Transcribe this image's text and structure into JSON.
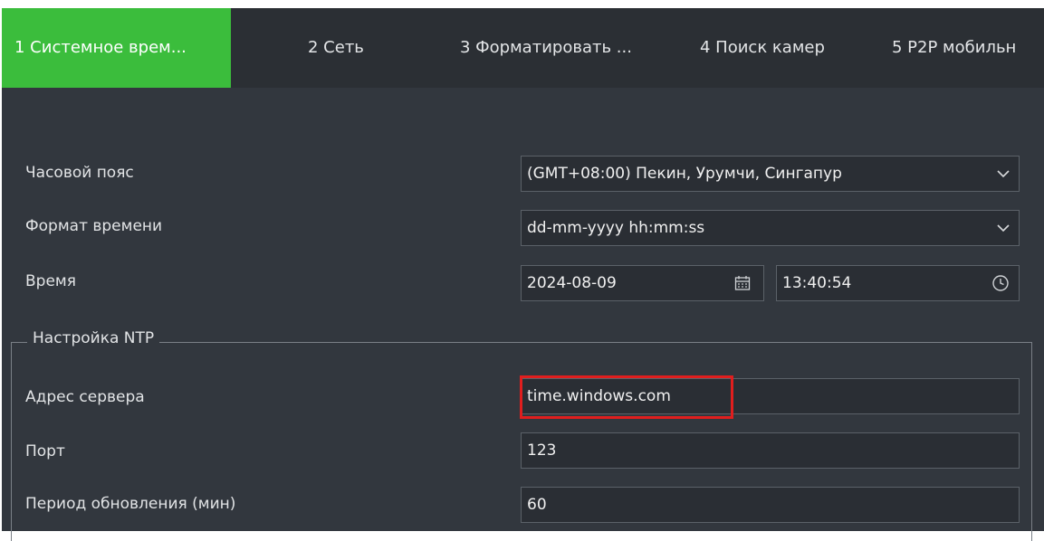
{
  "tabs": [
    {
      "label": "1 Системное врем...",
      "active": true
    },
    {
      "label": "2 Сеть",
      "active": false
    },
    {
      "label": "3 Форматировать ...",
      "active": false
    },
    {
      "label": "4 Поиск камер",
      "active": false
    },
    {
      "label": "5 P2P мобильн",
      "active": false
    }
  ],
  "settings": {
    "timezone_label": "Часовой пояс",
    "timezone_value": "(GMT+08:00) Пекин, Урумчи, Сингапур",
    "time_format_label": "Формат времени",
    "time_format_value": "dd-mm-yyyy hh:mm:ss",
    "time_label": "Время",
    "date_value": "2024-08-09",
    "time_value": "13:40:54"
  },
  "ntp": {
    "legend": "Настройка NTP",
    "server_label": "Адрес сервера",
    "server_value": "time.windows.com",
    "port_label": "Порт",
    "port_value": "123",
    "period_label": "Период обновления (мин)",
    "period_value": "60"
  },
  "icons": {
    "dropdown": "chevron-down-icon",
    "date": "calendar-icon",
    "time": "clock-icon"
  },
  "colors": {
    "active_tab": "#3bbd3c",
    "highlight": "#e01e1e",
    "background": "#32373e",
    "tabbar": "#2b2f34"
  }
}
